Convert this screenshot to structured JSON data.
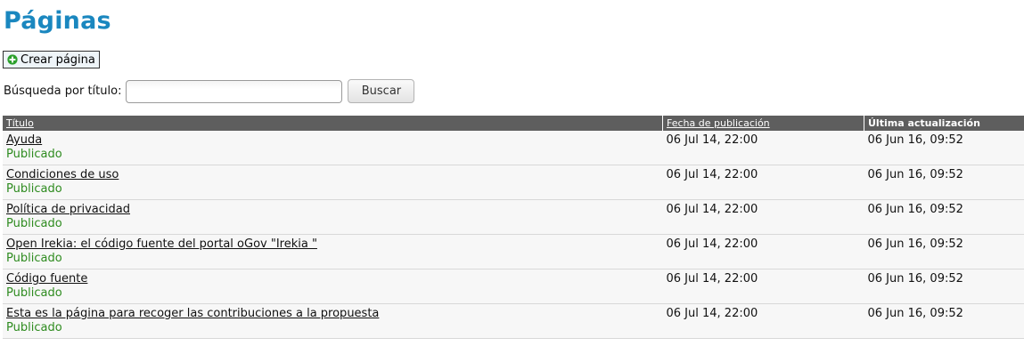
{
  "header": {
    "title": "Páginas"
  },
  "toolbar": {
    "create_label": "Crear página"
  },
  "search": {
    "label": "Búsqueda por título:",
    "value": "",
    "placeholder": "",
    "button_label": "Buscar"
  },
  "table": {
    "columns": {
      "title": "Título",
      "published": "Fecha de publicación",
      "updated": "Última actualización"
    },
    "rows": [
      {
        "title": "Ayuda",
        "status": "Publicado",
        "published": "06 Jul 14, 22:00",
        "updated": "06 Jun 16, 09:52"
      },
      {
        "title": "Condiciones de uso",
        "status": "Publicado",
        "published": "06 Jul 14, 22:00",
        "updated": "06 Jun 16, 09:52"
      },
      {
        "title": "Política de privacidad",
        "status": "Publicado",
        "published": "06 Jul 14, 22:00",
        "updated": "06 Jun 16, 09:52"
      },
      {
        "title": "Open Irekia: el código fuente del portal oGov \"Irekia \"",
        "status": "Publicado",
        "published": "06 Jul 14, 22:00",
        "updated": "06 Jun 16, 09:52"
      },
      {
        "title": "Código fuente",
        "status": "Publicado",
        "published": "06 Jul 14, 22:00",
        "updated": "06 Jun 16, 09:52"
      },
      {
        "title": "Esta es la página para recoger las contribuciones a la propuesta",
        "status": "Publicado",
        "published": "06 Jul 14, 22:00",
        "updated": "06 Jun 16, 09:52"
      }
    ]
  },
  "colors": {
    "title": "#1a87bf",
    "header_bg": "#5e5e5e",
    "status": "#2e8b1f",
    "plus_icon": "#2ca02c"
  },
  "icons": {
    "create": "plus-circle-icon"
  }
}
